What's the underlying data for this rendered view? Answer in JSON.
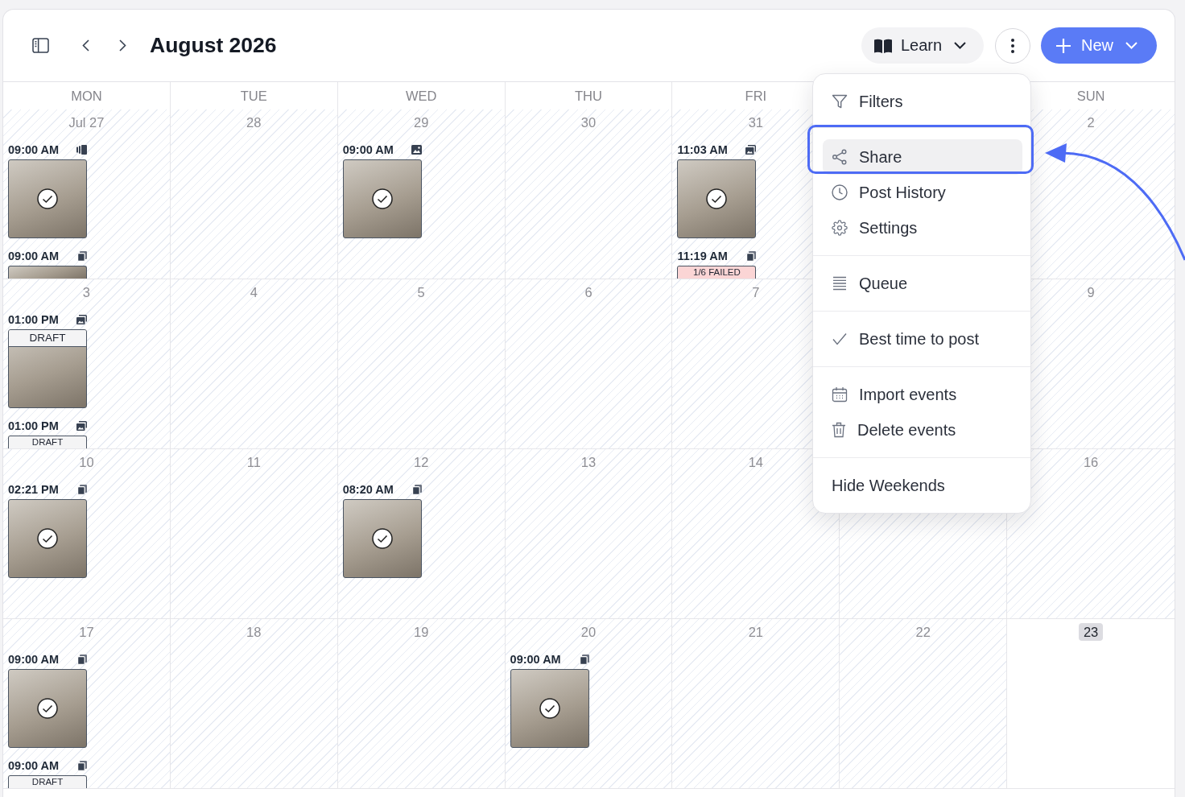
{
  "toolbar": {
    "title": "August 2026",
    "learn_label": "Learn",
    "new_label": "New"
  },
  "weekdays": {
    "mon": "MON",
    "tue": "TUE",
    "wed": "WED",
    "thu": "THU",
    "fri": "FRI",
    "sun": "SUN"
  },
  "weeks": [
    {
      "mon": {
        "date": "Jul 27",
        "past": true,
        "today": false,
        "events": [
          {
            "time": "09:00 AM",
            "kind": "carousel",
            "published": true
          },
          {
            "time": "09:00 AM",
            "kind": "copies"
          }
        ]
      },
      "tue": {
        "date": "28",
        "past": true,
        "today": false
      },
      "wed": {
        "date": "29",
        "past": true,
        "today": false,
        "events": [
          {
            "time": "09:00 AM",
            "kind": "image",
            "published": true
          }
        ]
      },
      "thu": {
        "date": "30",
        "past": true,
        "today": false
      },
      "fri": {
        "date": "31",
        "past": true,
        "today": false,
        "events": [
          {
            "time": "11:03 AM",
            "kind": "album",
            "published": true
          },
          {
            "time": "11:19 AM",
            "kind": "copies",
            "failed": true,
            "label": "1/6 FAILED"
          }
        ]
      },
      "sun": {
        "date": "2",
        "past": true,
        "today": false
      }
    },
    {
      "mon": {
        "date": "3",
        "past": true,
        "today": false,
        "events": [
          {
            "time": "01:00 PM",
            "kind": "album",
            "published": false,
            "failed": false,
            "label": "DRAFT"
          },
          {
            "time": "01:00 PM",
            "kind": "album",
            "failed": false,
            "label": "DRAFT"
          }
        ]
      },
      "tue": {
        "date": "4",
        "past": true,
        "today": false
      },
      "wed": {
        "date": "5",
        "past": true,
        "today": false
      },
      "thu": {
        "date": "6",
        "past": true,
        "today": false
      },
      "fri": {
        "date": "7",
        "past": true,
        "today": false
      },
      "sun": {
        "date": "9",
        "past": true,
        "today": false
      }
    },
    {
      "mon": {
        "date": "10",
        "past": true,
        "today": false,
        "events": [
          {
            "time": "02:21 PM",
            "kind": "copies",
            "published": true
          }
        ]
      },
      "tue": {
        "date": "11",
        "past": true,
        "today": false
      },
      "wed": {
        "date": "12",
        "past": true,
        "today": false,
        "events": [
          {
            "time": "08:20 AM",
            "kind": "copies",
            "published": true
          }
        ]
      },
      "thu": {
        "date": "13",
        "past": true,
        "today": false
      },
      "fri": {
        "date": "14",
        "past": true,
        "today": false
      },
      "sat": {
        "past": true
      },
      "sun": {
        "date": "16",
        "past": true,
        "today": false
      }
    },
    {
      "mon": {
        "date": "17",
        "past": true,
        "today": false,
        "events": [
          {
            "time": "09:00 AM",
            "kind": "copies",
            "published": true
          },
          {
            "time": "09:00 AM",
            "kind": "copies",
            "failed": false,
            "label": "DRAFT"
          }
        ]
      },
      "tue": {
        "date": "18",
        "past": true,
        "today": false
      },
      "wed": {
        "date": "19",
        "past": true,
        "today": false
      },
      "thu": {
        "date": "20",
        "past": true,
        "today": false,
        "events": [
          {
            "time": "09:00 AM",
            "kind": "copies",
            "published": true
          }
        ]
      },
      "fri": {
        "date": "21",
        "past": true,
        "today": false
      },
      "sat": {
        "date": "22",
        "past": true,
        "today": false
      },
      "sun": {
        "date": "23",
        "past": false,
        "today": true
      }
    }
  ],
  "menu": {
    "sections": [
      {
        "items": [
          {
            "kind": "filter",
            "label": "Filters",
            "selected": false
          }
        ]
      },
      {
        "items": [
          {
            "kind": "share",
            "label": "Share",
            "selected": true
          },
          {
            "kind": "history",
            "label": "Post History",
            "selected": false
          },
          {
            "kind": "settings",
            "label": "Settings",
            "selected": false
          }
        ]
      },
      {
        "items": [
          {
            "kind": "queue",
            "label": "Queue",
            "selected": false
          }
        ]
      },
      {
        "items": [
          {
            "kind": "toggle",
            "label": "Best time to post",
            "checked": true,
            "selected": false
          }
        ]
      },
      {
        "items": [
          {
            "kind": "import",
            "label": "Import events",
            "selected": false
          },
          {
            "kind": "delete",
            "label": "Delete events",
            "selected": false
          }
        ]
      },
      {
        "items": [
          {
            "kind": "toggle",
            "label": "Hide Weekends",
            "checked": false,
            "selected": false
          }
        ]
      }
    ]
  }
}
